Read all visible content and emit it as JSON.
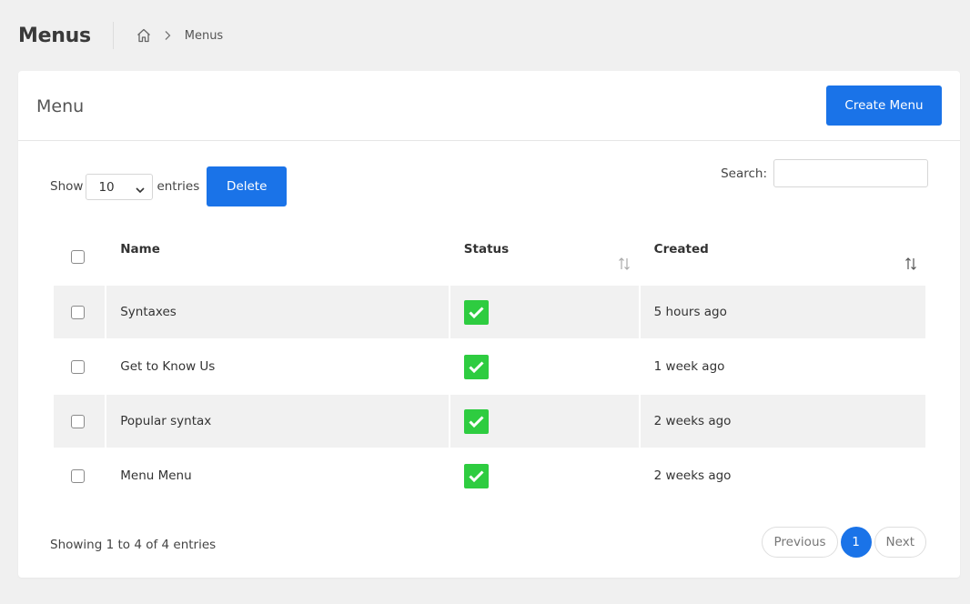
{
  "page": {
    "title": "Menus"
  },
  "breadcrumb": {
    "home_icon": "home-icon",
    "current": "Menus"
  },
  "card": {
    "title": "Menu",
    "create_label": "Create Menu"
  },
  "controls": {
    "show_label": "Show",
    "length_value": "10",
    "entries_label": "entries",
    "delete_label": "Delete",
    "search_label": "Search:",
    "search_value": ""
  },
  "table": {
    "columns": {
      "name": "Name",
      "status": "Status",
      "created": "Created"
    },
    "rows": [
      {
        "name": "Syntaxes",
        "status": true,
        "created": "5 hours ago"
      },
      {
        "name": "Get to Know Us",
        "status": true,
        "created": "1 week ago"
      },
      {
        "name": "Popular syntax",
        "status": true,
        "created": "2 weeks ago"
      },
      {
        "name": "Menu Menu",
        "status": true,
        "created": "2 weeks ago"
      }
    ]
  },
  "footer": {
    "info": "Showing 1 to 4 of 4 entries",
    "previous": "Previous",
    "current_page": "1",
    "next": "Next"
  },
  "colors": {
    "primary": "#1a73e8",
    "status_active": "#2ecc40",
    "row_shade": "#f1f1f1"
  }
}
